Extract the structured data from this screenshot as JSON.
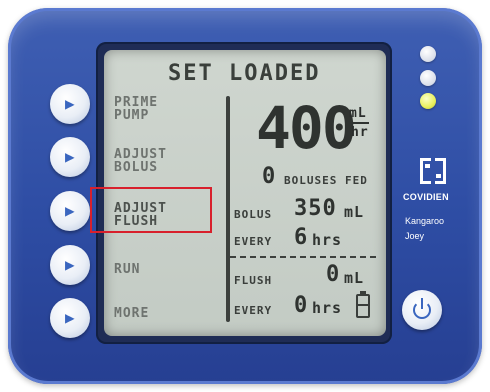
{
  "screen": {
    "title": "SET LOADED",
    "menu": [
      {
        "label": "PRIME\nPUMP"
      },
      {
        "label": "ADJUST\nBOLUS"
      },
      {
        "label": "ADJUST\nFLUSH"
      },
      {
        "label": "RUN"
      },
      {
        "label": "MORE"
      }
    ],
    "rate": {
      "value": "400",
      "unit_top": "mL",
      "unit_bottom": "hr"
    },
    "boluses": {
      "count": "0",
      "label": "BOLUSES FED"
    },
    "bolus": {
      "label": "BOLUS",
      "value": "350",
      "unit": "mL",
      "every_label": "EVERY",
      "every_value": "6",
      "every_unit": "hrs"
    },
    "flush": {
      "label": "FLUSH",
      "value": "0",
      "unit": "mL",
      "every_label": "EVERY",
      "every_value": "0",
      "every_unit": "hrs"
    }
  },
  "branding": {
    "brand": "COVIDIEN",
    "model_line1": "Kangaroo",
    "model_line2": "Joey"
  },
  "colors": {
    "body": "#2e4da4",
    "lcd": "#c9d0c9",
    "highlight": "#d8202c",
    "indicator_yellow": "#e9f05c"
  }
}
